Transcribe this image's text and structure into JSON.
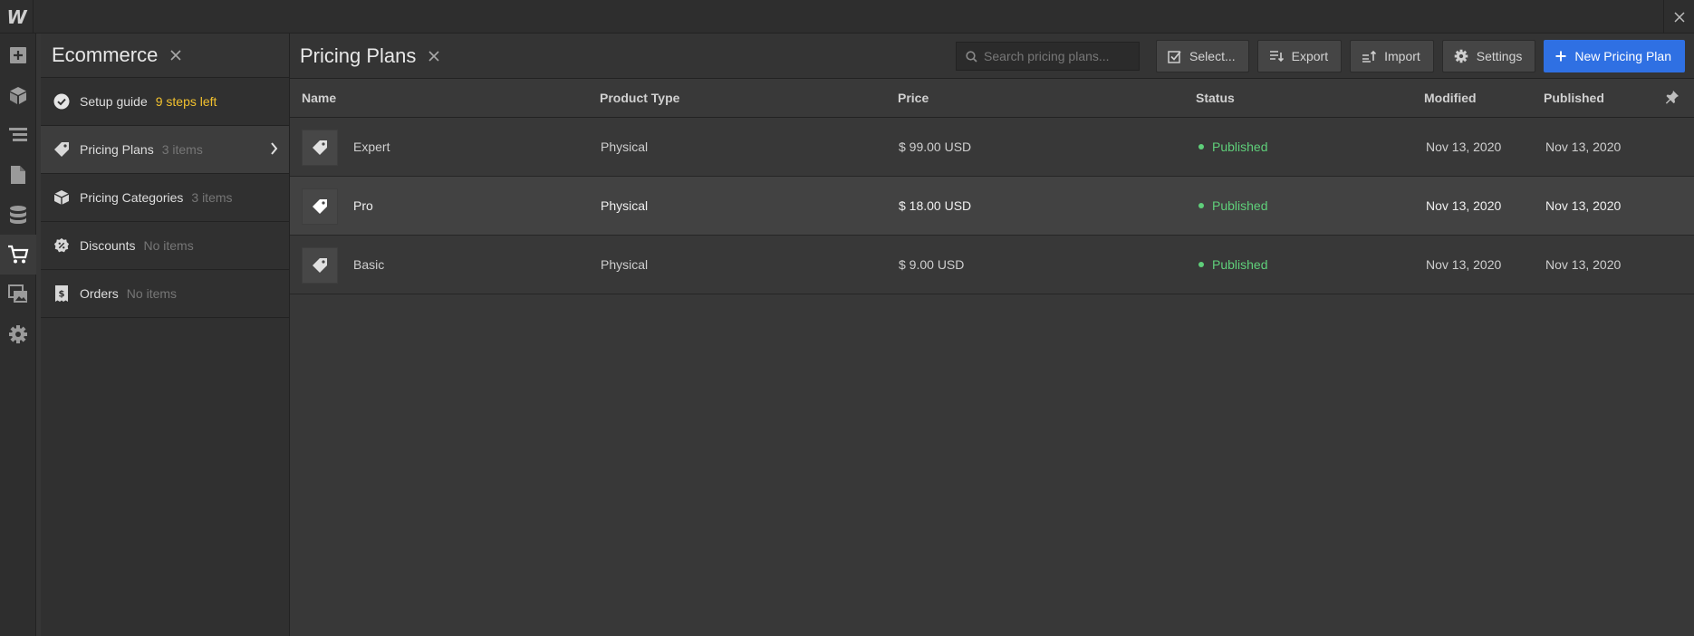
{
  "app": {
    "logo": "W",
    "accent": "#2f70e3",
    "status_color": "#5fcf7a",
    "warn_color": "#f2c12e"
  },
  "rail": [
    {
      "name": "add-panel-icon"
    },
    {
      "name": "components-icon"
    },
    {
      "name": "navigator-icon"
    },
    {
      "name": "pages-icon"
    },
    {
      "name": "cms-icon"
    },
    {
      "name": "ecommerce-icon",
      "active": true
    },
    {
      "name": "assets-icon"
    },
    {
      "name": "settings-icon"
    }
  ],
  "panel": {
    "title": "Ecommerce",
    "items": [
      {
        "label": "Setup guide",
        "sub": "9 steps left",
        "icon": "check-circle-icon"
      },
      {
        "label": "Pricing Plans",
        "sub": "3 items",
        "icon": "tag-icon",
        "active": true
      },
      {
        "label": "Pricing Categories",
        "sub": "3 items",
        "icon": "category-box-icon"
      },
      {
        "label": "Discounts",
        "sub": "No items",
        "icon": "discount-badge-icon"
      },
      {
        "label": "Orders",
        "sub": "No items",
        "icon": "receipt-icon"
      }
    ]
  },
  "main": {
    "title": "Pricing Plans",
    "search_placeholder": "Search pricing plans...",
    "buttons": {
      "select": "Select...",
      "export": "Export",
      "import": "Import",
      "settings": "Settings",
      "new": "New Pricing Plan"
    },
    "columns": [
      "Name",
      "Product Type",
      "Price",
      "Status",
      "Modified",
      "Published"
    ],
    "rows": [
      {
        "name": "Expert",
        "type": "Physical",
        "price": "$ 99.00 USD",
        "status": "Published",
        "modified": "Nov 13, 2020",
        "published": "Nov 13, 2020"
      },
      {
        "name": "Pro",
        "type": "Physical",
        "price": "$ 18.00 USD",
        "status": "Published",
        "modified": "Nov 13, 2020",
        "published": "Nov 13, 2020",
        "highlighted": true
      },
      {
        "name": "Basic",
        "type": "Physical",
        "price": "$ 9.00 USD",
        "status": "Published",
        "modified": "Nov 13, 2020",
        "published": "Nov 13, 2020"
      }
    ]
  }
}
